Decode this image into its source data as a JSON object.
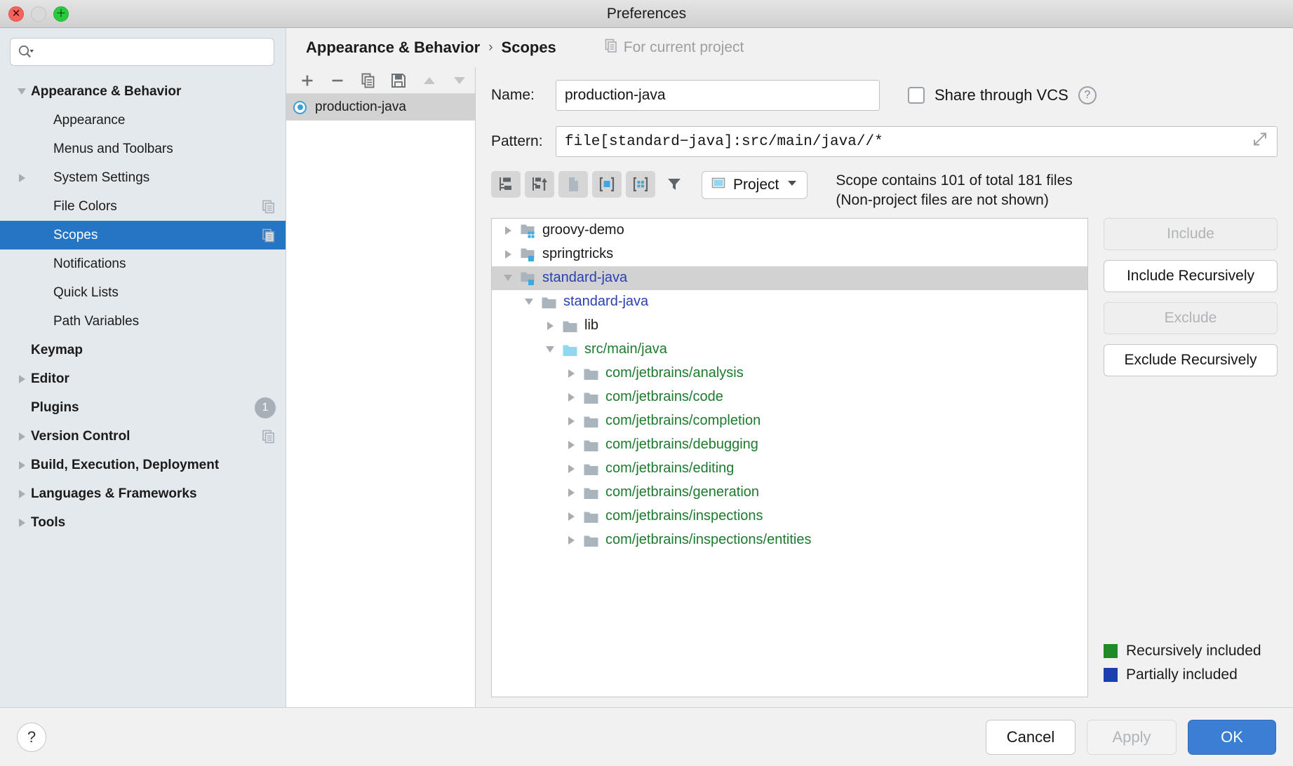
{
  "window": {
    "title": "Preferences",
    "traffic": {
      "close": "✕",
      "minimize": "",
      "zoom": "＋"
    }
  },
  "search": {
    "placeholder": "",
    "value": "",
    "icon": "search-icon"
  },
  "sidebar": {
    "items": [
      {
        "label": "Appearance & Behavior",
        "level": 1,
        "bold": true,
        "arrow": "down",
        "selected": false,
        "badge": null
      },
      {
        "label": "Appearance",
        "level": 2,
        "bold": false,
        "arrow": "none",
        "selected": false,
        "badge": null
      },
      {
        "label": "Menus and Toolbars",
        "level": 2,
        "bold": false,
        "arrow": "none",
        "selected": false,
        "badge": null
      },
      {
        "label": "System Settings",
        "level": 2,
        "bold": false,
        "arrow": "right",
        "selected": false,
        "badge": null
      },
      {
        "label": "File Colors",
        "level": 2,
        "bold": false,
        "arrow": "none",
        "selected": false,
        "badge": "copy"
      },
      {
        "label": "Scopes",
        "level": 2,
        "bold": false,
        "arrow": "none",
        "selected": true,
        "badge": "copy"
      },
      {
        "label": "Notifications",
        "level": 2,
        "bold": false,
        "arrow": "none",
        "selected": false,
        "badge": null
      },
      {
        "label": "Quick Lists",
        "level": 2,
        "bold": false,
        "arrow": "none",
        "selected": false,
        "badge": null
      },
      {
        "label": "Path Variables",
        "level": 2,
        "bold": false,
        "arrow": "none",
        "selected": false,
        "badge": null
      },
      {
        "label": "Keymap",
        "level": 1,
        "bold": true,
        "arrow": "none",
        "selected": false,
        "badge": null
      },
      {
        "label": "Editor",
        "level": 1,
        "bold": true,
        "arrow": "right",
        "selected": false,
        "badge": null
      },
      {
        "label": "Plugins",
        "level": 1,
        "bold": true,
        "arrow": "none",
        "selected": false,
        "badge": "count",
        "count": "1"
      },
      {
        "label": "Version Control",
        "level": 1,
        "bold": true,
        "arrow": "right",
        "selected": false,
        "badge": "copy"
      },
      {
        "label": "Build, Execution, Deployment",
        "level": 1,
        "bold": true,
        "arrow": "right",
        "selected": false,
        "badge": null
      },
      {
        "label": "Languages & Frameworks",
        "level": 1,
        "bold": true,
        "arrow": "right",
        "selected": false,
        "badge": null
      },
      {
        "label": "Tools",
        "level": 1,
        "bold": true,
        "arrow": "right",
        "selected": false,
        "badge": null
      }
    ]
  },
  "breadcrumb": {
    "parent": "Appearance & Behavior",
    "separator": "›",
    "current": "Scopes",
    "note": "For current project",
    "note_icon": "copy-icon"
  },
  "scope_toolbar": {
    "add": "+",
    "remove": "−",
    "copy": "copy-icon",
    "save": "save-icon",
    "move_up": "arrow-up-icon",
    "move_down": "arrow-down-icon"
  },
  "scope_list": {
    "items": [
      {
        "label": "production-java",
        "selected": true
      }
    ]
  },
  "form": {
    "name_label": "Name:",
    "name_value": "production-java",
    "name_placeholder": "",
    "share_label": "Share through VCS",
    "share_checked": false,
    "help_glyph": "?",
    "pattern_label": "Pattern:",
    "pattern_value": "file[standard−java]:src/main/java//*",
    "pattern_placeholder": ""
  },
  "tree_toolbar": {
    "buttons": [
      {
        "name": "flatten-packages-icon",
        "active": false
      },
      {
        "name": "compact-middle-packages-icon",
        "active": false
      },
      {
        "name": "show-files-icon",
        "active": false
      },
      {
        "name": "show-modules-icon",
        "active": true
      },
      {
        "name": "group-by-module-group-icon",
        "active": true
      },
      {
        "name": "filter-icon",
        "active": false
      }
    ],
    "project_selector": "Project",
    "chevron": "▼"
  },
  "scope_info": {
    "line1": "Scope contains 101 of total 181 files",
    "line2": "(Non-project files are not shown)",
    "contained": "101",
    "total": "181"
  },
  "file_tree": {
    "nodes": [
      {
        "label": "groovy-demo",
        "indent": 0,
        "arrow": "right",
        "icon": "module-folder-icon",
        "color": "plain",
        "selected": false
      },
      {
        "label": "springtricks",
        "indent": 0,
        "arrow": "right",
        "icon": "module-folder-icon",
        "color": "plain",
        "selected": false
      },
      {
        "label": "standard-java",
        "indent": 0,
        "arrow": "down",
        "icon": "module-folder-icon",
        "color": "blue",
        "selected": true
      },
      {
        "label": "standard-java",
        "indent": 1,
        "arrow": "down",
        "icon": "folder-icon",
        "color": "blue",
        "selected": false
      },
      {
        "label": "lib",
        "indent": 2,
        "arrow": "right",
        "icon": "folder-icon",
        "color": "plain",
        "selected": false
      },
      {
        "label": "src/main/java",
        "indent": 2,
        "arrow": "down",
        "icon": "source-folder-icon",
        "color": "green",
        "selected": false
      },
      {
        "label": "com/jetbrains/analysis",
        "indent": 3,
        "arrow": "right",
        "icon": "folder-icon",
        "color": "green",
        "selected": false
      },
      {
        "label": "com/jetbrains/code",
        "indent": 3,
        "arrow": "right",
        "icon": "folder-icon",
        "color": "green",
        "selected": false
      },
      {
        "label": "com/jetbrains/completion",
        "indent": 3,
        "arrow": "right",
        "icon": "folder-icon",
        "color": "green",
        "selected": false
      },
      {
        "label": "com/jetbrains/debugging",
        "indent": 3,
        "arrow": "right",
        "icon": "folder-icon",
        "color": "green",
        "selected": false
      },
      {
        "label": "com/jetbrains/editing",
        "indent": 3,
        "arrow": "right",
        "icon": "folder-icon",
        "color": "green",
        "selected": false
      },
      {
        "label": "com/jetbrains/generation",
        "indent": 3,
        "arrow": "right",
        "icon": "folder-icon",
        "color": "green",
        "selected": false
      },
      {
        "label": "com/jetbrains/inspections",
        "indent": 3,
        "arrow": "right",
        "icon": "folder-icon",
        "color": "green",
        "selected": false
      },
      {
        "label": "com/jetbrains/inspections/entities",
        "indent": 3,
        "arrow": "right",
        "icon": "folder-icon",
        "color": "green",
        "selected": false
      }
    ]
  },
  "side_buttons": [
    {
      "label": "Include",
      "enabled": false
    },
    {
      "label": "Include Recursively",
      "enabled": true
    },
    {
      "label": "Exclude",
      "enabled": false
    },
    {
      "label": "Exclude Recursively",
      "enabled": true
    }
  ],
  "legend": [
    {
      "label": "Recursively included",
      "color": "#1e8b27"
    },
    {
      "label": "Partially included",
      "color": "#1b3fae"
    }
  ],
  "footer": {
    "help": "?",
    "cancel": "Cancel",
    "apply": "Apply",
    "ok": "OK",
    "apply_enabled": false
  },
  "colors": {
    "selection_blue": "#2675c4",
    "primary_button": "#3b7fd4",
    "recursively_included": "#1e8b27",
    "partially_included": "#1b3fae",
    "tree_green": "#1e7a2e",
    "tree_blue": "#2a3fb0"
  }
}
